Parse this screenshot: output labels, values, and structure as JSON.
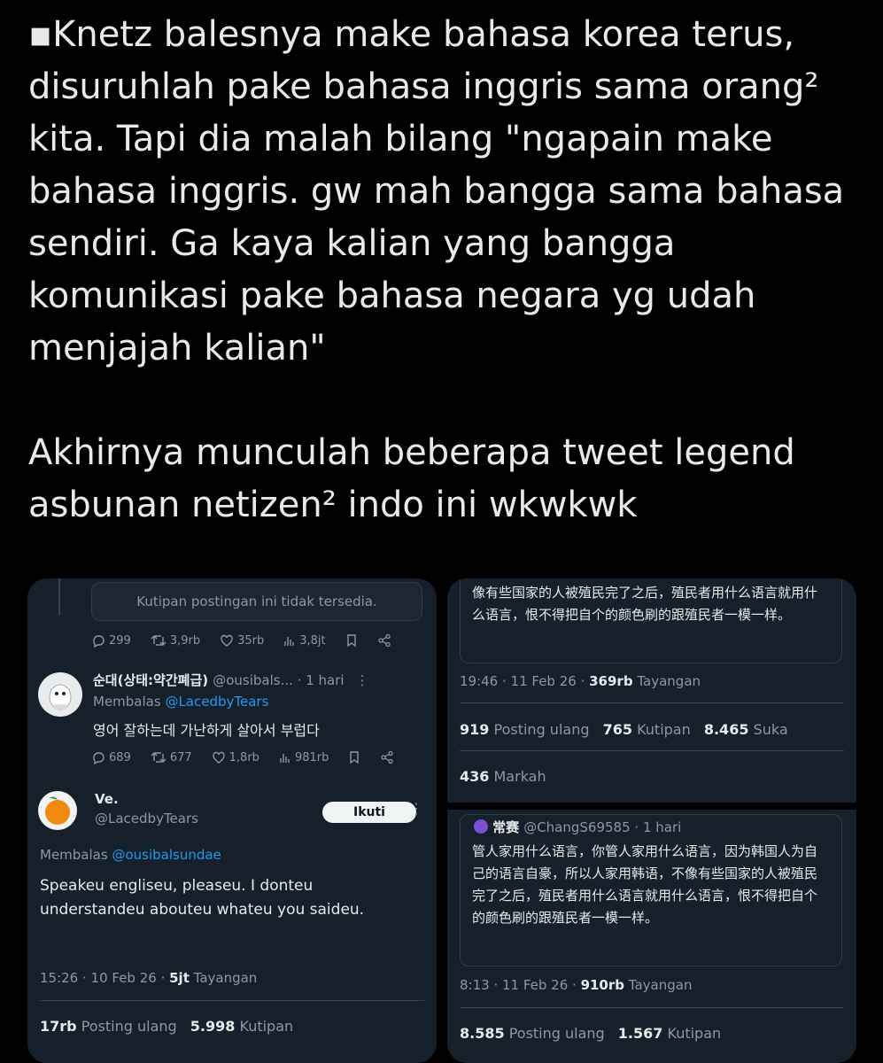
{
  "intro": {
    "paragraph1": "▪Knetz balesnya make bahasa korea terus, disuruhlah pake bahasa inggris sama orang² kita. Tapi dia malah bilang \"ngapain make bahasa inggris. gw mah bangga sama bahasa sendiri. Ga kaya kalian yang bangga komunikasi pake bahasa negara yg udah menjajah kalian\"",
    "paragraph2": "Akhirnya munculah beberapa tweet legend asbunan netizen² indo ini wkwkwk"
  },
  "left_panel": {
    "quote_unavailable": "Kutipan postingan ini tidak tersedia.",
    "actions_1": {
      "replies": "299",
      "reposts": "3,9rb",
      "likes": "35rb",
      "views": "3,8jt"
    },
    "reply_tweet": {
      "display_name": "순대(상태:약간폐급)",
      "handle_time": "@ousibals... · 1 hari",
      "replying_label": "Membalas",
      "replying_handle": "@LacedbyTears",
      "text": "영어 잘하는데 가난하게 살아서 부럽다"
    },
    "actions_2": {
      "replies": "689",
      "reposts": "677",
      "likes": "1,8rb",
      "views": "981rb"
    },
    "main_tweet": {
      "display_name": "Ve.",
      "handle": "@LacedbyTears",
      "follow_label": "Ikuti",
      "replying_label": "Membalas",
      "replying_handle": "@ousibalsundae",
      "text": "Speakeu engliseu, pleaseu. I donteu understandeu abouteu whateu you saideu.",
      "meta": "15:26 · 10 Feb 26 · ",
      "views_count": "5jt",
      "views_label": "Tayangan",
      "reposts_count": "17rb",
      "reposts_label": "Posting ulang",
      "quotes_count": "5.998",
      "quotes_label": "Kutipan"
    }
  },
  "right_top": {
    "text": "像有些国家的人被殖民完了之后，殖民者用什么语言就用什么语言，恨不得把自个的颜色刷的跟殖民者一模一样。",
    "meta": "19:46 · 11 Feb 26 · ",
    "views_count": "369rb",
    "views_label": "Tayangan",
    "reposts_count": "919",
    "reposts_label": "Posting ulang",
    "quotes_count": "765",
    "quotes_label": "Kutipan",
    "likes_count": "8.465",
    "likes_label": "Suka",
    "bookmarks_count": "436",
    "bookmarks_label": "Markah"
  },
  "right_bottom": {
    "display_name": "常赛",
    "handle_time": "@ChangS69585 · 1 hari",
    "text": "管人家用什么语言，你管人家用什么语言，因为韩国人为自己的语言自豪，所以人家用韩语，不像有些国家的人被殖民完了之后，殖民者用什么语言就用什么语言，恨不得把自个的颜色刷的跟殖民者一模一样。",
    "meta": "8:13 · 11 Feb 26 · ",
    "views_count": "910rb",
    "views_label": "Tayangan",
    "reposts_count": "8.585",
    "reposts_label": "Posting ulang",
    "quotes_count": "1.567",
    "quotes_label": "Kutipan"
  },
  "colors": {
    "background": "#000000",
    "panel": "#15202b",
    "accent": "#1d9bf0",
    "muted": "#8b98a5"
  }
}
